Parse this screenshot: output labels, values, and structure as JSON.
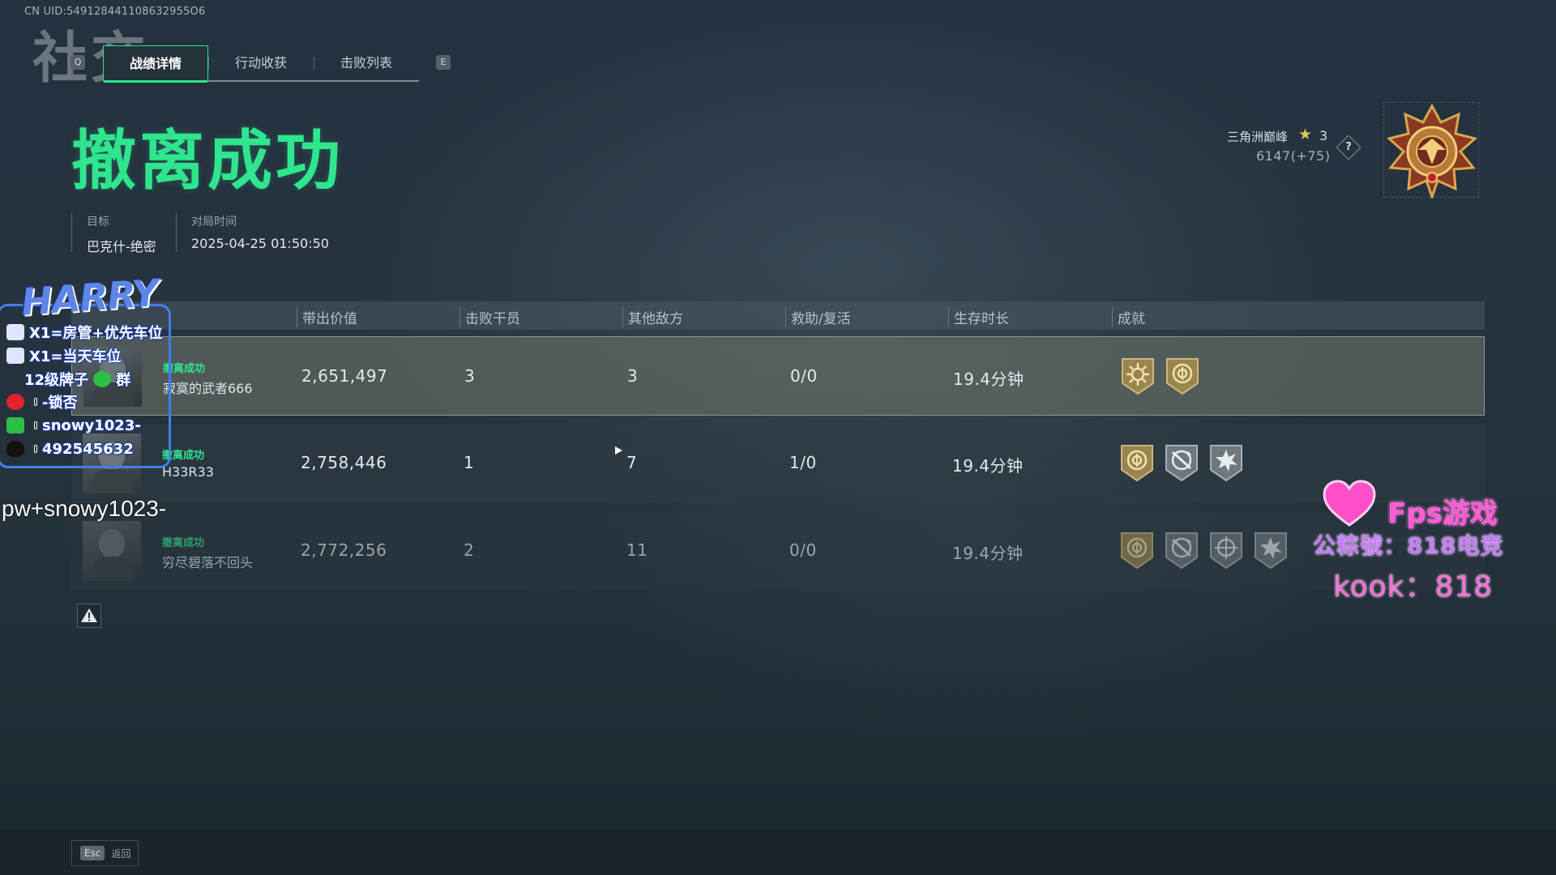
{
  "uid": "CN UID:549128441108632955O6",
  "background_text": "社交",
  "tabs": {
    "key_prev": "Q",
    "key_next": "E",
    "items": [
      {
        "label": "战绩详情",
        "active": true
      },
      {
        "label": "行动收获",
        "active": false
      },
      {
        "label": "击败列表",
        "active": false
      }
    ]
  },
  "result": {
    "title": "撤离成功",
    "target_label": "目标",
    "target_value": "巴克什-绝密",
    "time_label": "对局时间",
    "time_value": "2025-04-25 01:50:50"
  },
  "rank": {
    "name": "三角洲巅峰",
    "stars": "3",
    "points": "6147(+75)",
    "help": "?"
  },
  "table": {
    "headers": [
      "带出价值",
      "击败干员",
      "其他敌方",
      "救助/复活",
      "生存时长",
      "成就"
    ],
    "rows": [
      {
        "status": "撤离成功",
        "name": "寂寞的武者666",
        "value": "2,651,497",
        "kills": "3",
        "other": "3",
        "assist": "0/0",
        "survival": "19.4分钟",
        "achievements": [
          "sun-badge-icon",
          "target-badge-icon"
        ]
      },
      {
        "status": "撤离成功",
        "name": "H33R33",
        "value": "2,758,446",
        "kills": "1",
        "other": "7",
        "assist": "1/0",
        "survival": "19.4分钟",
        "achievements": [
          "target-badge-icon",
          "wrench-badge-icon",
          "burst-badge-icon"
        ]
      },
      {
        "status": "撤离成功",
        "name": "穷尽碧落不回头",
        "value": "2,772,256",
        "kills": "2",
        "other": "11",
        "assist": "0/0",
        "survival": "19.4分钟",
        "achievements": [
          "target-badge-icon",
          "wrench-badge-icon",
          "crosshair-badge-icon",
          "burst-badge-icon"
        ]
      }
    ]
  },
  "footer": {
    "esc_key": "Esc",
    "esc_label": "返回"
  },
  "overlay": {
    "logo": "HARRY",
    "lines": [
      "X1=房管+优先车位",
      "X1=当天车位",
      "12级牌子",
      "群",
      "-锁否",
      "snowy1023-",
      "492545632"
    ],
    "big_text": "pw+snowy1023-",
    "fps_title": "Fps游戏",
    "fps_line2": "公粽號：818电竞",
    "fps_line3": "kook：818"
  },
  "colors": {
    "accent_green": "#2fe68f",
    "badge_gold": "#b59a55",
    "badge_gray": "#8f989f",
    "overlay_blue": "#3f7ff0",
    "overlay_pink": "#ff5fd0"
  }
}
